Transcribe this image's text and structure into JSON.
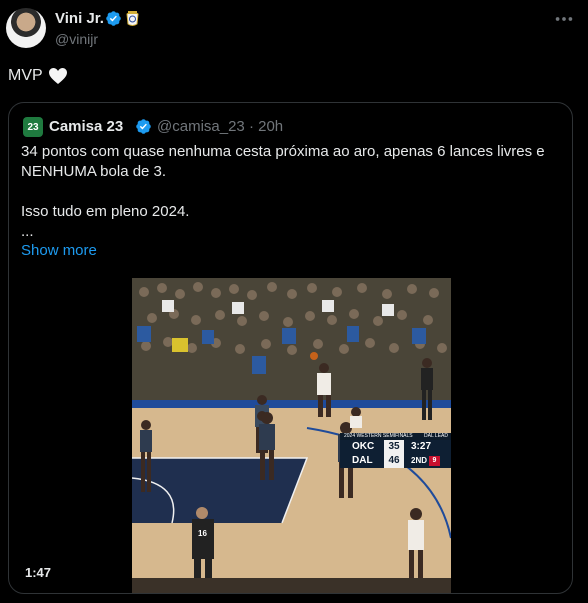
{
  "tweet": {
    "author_name": "Vini Jr.",
    "handle": "@vinijr",
    "text": "MVP",
    "emoji": "white-heart",
    "verified_color": "#1d9bf0"
  },
  "quoted_tweet": {
    "author_name": "Camisa 23",
    "avatar_text": "23",
    "handle": "@camisa_23",
    "separator": "·",
    "time": "20h",
    "body_lines": [
      "34 pontos com quase nenhuma cesta próxima ao aro, apenas 6 lances livres e NENHUMA bola de 3.",
      "",
      "Isso tudo em pleno 2024.",
      "..."
    ],
    "show_more_label": "Show more",
    "video": {
      "duration": "1:47",
      "scorebug": {
        "header": "2024 WESTERN SEMIFINALS",
        "lead_label": "DAL LEAD",
        "team1": "OKC",
        "seed1": "1",
        "score1": "35",
        "team2": "DAL",
        "seed2": "5",
        "score2": "46",
        "clock": "3:27",
        "period": "2ND",
        "fouls": "9"
      },
      "ref_number": "16"
    }
  },
  "icons": {
    "more": "more-horizontal-icon",
    "verified": "verified-badge-icon",
    "club": "real-madrid-badge-icon"
  }
}
